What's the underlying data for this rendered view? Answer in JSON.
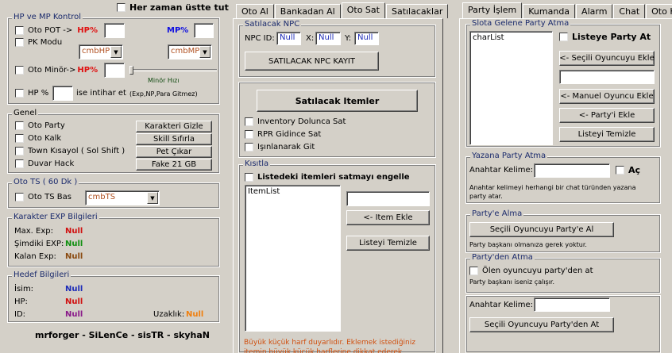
{
  "colors": {
    "null_blue": "#1c2bb8",
    "null_red": "#d01010",
    "null_green": "#109010",
    "null_brown": "#8a4a10",
    "null_purple": "#8a1a8a",
    "null_orange": "#f08010",
    "hp_red": "#e01010",
    "mp_blue": "#1010e0",
    "hint_orange": "#d05010"
  },
  "left": {
    "always_on_top": "Her zaman üstte tut",
    "hpmp": {
      "title": "HP ve MP Kontrol",
      "oto_pot": "Oto POT ->",
      "hp_pct": "HP%",
      "mp_pct": "MP%",
      "pk_modu": "PK Modu",
      "cmb_hp": "cmbHP",
      "cmb_mp": "cmbMP",
      "oto_minor": "Oto Minör->",
      "minor_hp_pct": "HP%",
      "minor_speed": "Minör Hızı",
      "hp_pct2": "HP %",
      "intihar": "ise intihar et",
      "intihar_note": "(Exp,NP,Para Gitmez)"
    },
    "genel": {
      "title": "Genel",
      "oto_party": "Oto Party",
      "oto_kalk": "Oto Kalk",
      "town": "Town Kısayol ( Sol Shift )",
      "duvar": "Duvar Hack",
      "btn_gizle": "Karakteri Gizle",
      "btn_skill": "Skill Sıfırla",
      "btn_pet": "Pet Çıkar",
      "btn_fake": "Fake 21 GB"
    },
    "ots": {
      "title": "Oto TS ( 60 Dk )",
      "oto_ts": "Oto TS Bas",
      "cmb_ts": "cmbTS"
    },
    "exp": {
      "title": "Karakter EXP Bilgileri",
      "max_label": "Max. Exp:",
      "max_val": "Null",
      "simdi_label": "Şimdiki EXP:",
      "simdi_val": "Null",
      "kalan_label": "Kalan Exp:",
      "kalan_val": "Null"
    },
    "hedef": {
      "title": "Hedef Bilgileri",
      "isim_label": "İsim:",
      "isim_val": "Null",
      "hp_label": "HP:",
      "hp_val": "Null",
      "id_label": "ID:",
      "id_val": "Null",
      "uzaklik_label": "Uzaklık:",
      "uzaklik_val": "Null"
    },
    "credits": "mrforger - SiLenCe - sisTR - skyhaN"
  },
  "middle": {
    "tabs": [
      "Oto Al",
      "Bankadan Al",
      "Oto Sat",
      "Satılacaklar"
    ],
    "active_tab": "Oto Sat",
    "npc": {
      "title": "Satılacak NPC",
      "npc_id_label": "NPC ID:",
      "npc_id_val": "Null",
      "x_label": "X:",
      "x_val": "Null",
      "y_label": "Y:",
      "y_val": "Null",
      "kayit_btn": "SATILACAK NPC KAYIT"
    },
    "items_btn": "Satılacak Itemler",
    "inventory_full": "Inventory Dolunca Sat",
    "rpr": "RPR Gidince Sat",
    "isin": "Işınlanarak Git",
    "kisitla": {
      "title": "Kısıtla",
      "engelle": "Listedeki itemleri satmayı engelle",
      "list_item": "ItemList",
      "ekle_btn": "<- Item Ekle",
      "temizle_btn": "Listeyi Temizle",
      "note": "Büyük küçük harf duyarlıdır. Eklemek istediğiniz itemin büyük küçük harflerine dikkat ederek"
    }
  },
  "right": {
    "tabs": [
      "Party İşlem",
      "Kumanda",
      "Alarm",
      "Chat",
      "Oto Kutu"
    ],
    "active_tab": "Party İşlem",
    "slota": {
      "title": "Slota Gelene Party Atma",
      "list_item": "charList",
      "listeye_party": "Listeye Party At",
      "secili_ekle": "<- Seçili Oyuncuyu Ekle",
      "manuel_ekle": "<- Manuel Oyuncu Ekle",
      "party_ekle": "<- Party'i Ekle",
      "temizle": "Listeyi Temizle"
    },
    "yazana": {
      "title": "Yazana Party Atma",
      "anahtar": "Anahtar Kelime:",
      "ac": "Aç",
      "desc": "Anahtar kelimeyi herhangi bir chat türünden yazana party atar."
    },
    "alma": {
      "title": "Party'e Alma",
      "btn": "Seçili Oyuncuyu Party'e Al",
      "note": "Party başkanı olmanıza gerek yoktur."
    },
    "atma": {
      "title": "Party'den Atma",
      "olen": "Ölen oyuncuyu party'den at",
      "note": "Party başkanı iseniz çalışır.",
      "anahtar": "Anahtar Kelime:",
      "btn": "Seçili Oyuncuyu Party'den At"
    }
  }
}
